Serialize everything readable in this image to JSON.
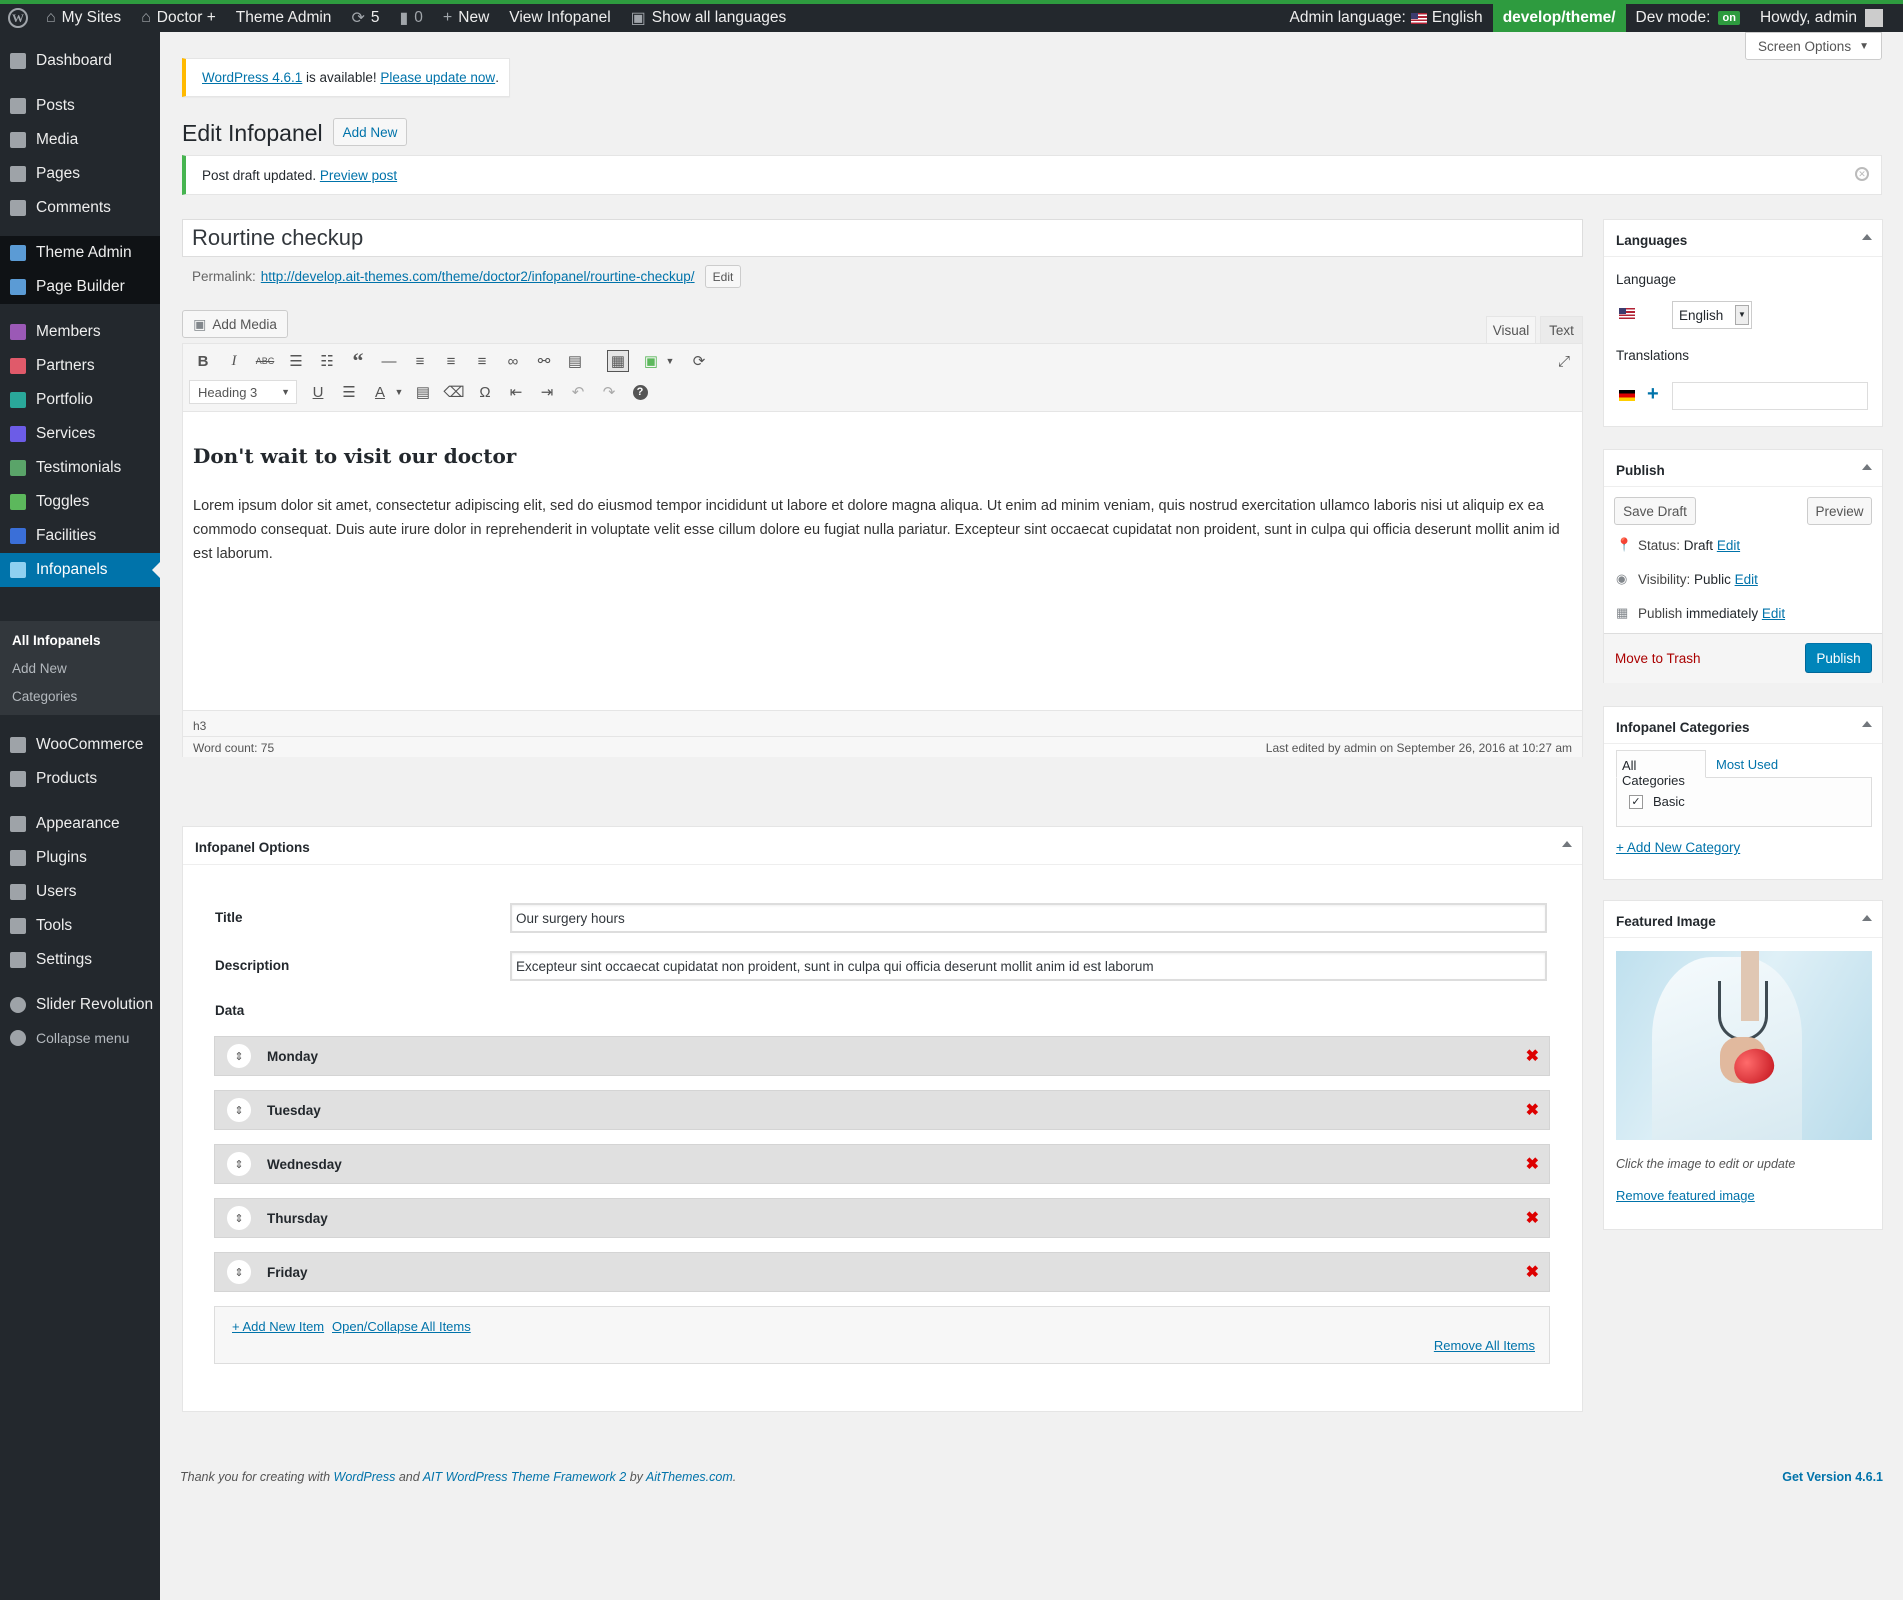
{
  "adminbar": {
    "my_sites": "My Sites",
    "site": "Doctor +",
    "theme_admin": "Theme Admin",
    "updates": "5",
    "comments": "0",
    "new": "New",
    "view": "View Infopanel",
    "show_langs": "Show all languages",
    "admin_lang_label": "Admin language:",
    "admin_lang_value": "English",
    "path": "develop/theme/",
    "dev_mode": "Dev mode:",
    "dev_state": "on",
    "howdy": "Howdy, admin"
  },
  "sidebar": {
    "items": [
      {
        "label": "Dashboard",
        "icon": "dashboard-icon"
      },
      {
        "label": "Posts",
        "icon": "pin-icon"
      },
      {
        "label": "Media",
        "icon": "media-icon"
      },
      {
        "label": "Pages",
        "icon": "pages-icon"
      },
      {
        "label": "Comments",
        "icon": "comments-icon"
      },
      {
        "label": "Theme Admin",
        "icon": "ait-icon"
      },
      {
        "label": "Page Builder",
        "icon": "ait-icon"
      },
      {
        "label": "Members",
        "icon": "members-icon"
      },
      {
        "label": "Partners",
        "icon": "partners-icon"
      },
      {
        "label": "Portfolio",
        "icon": "portfolio-icon"
      },
      {
        "label": "Services",
        "icon": "services-icon"
      },
      {
        "label": "Testimonials",
        "icon": "testimonials-icon"
      },
      {
        "label": "Toggles",
        "icon": "toggles-icon"
      },
      {
        "label": "Facilities",
        "icon": "facilities-icon"
      },
      {
        "label": "Infopanels",
        "icon": "infopanels-icon"
      },
      {
        "label": "WooCommerce",
        "icon": "woocommerce-icon"
      },
      {
        "label": "Products",
        "icon": "products-icon"
      },
      {
        "label": "Appearance",
        "icon": "appearance-icon"
      },
      {
        "label": "Plugins",
        "icon": "plugins-icon"
      },
      {
        "label": "Users",
        "icon": "users-icon"
      },
      {
        "label": "Tools",
        "icon": "tools-icon"
      },
      {
        "label": "Settings",
        "icon": "settings-icon"
      },
      {
        "label": "Slider Revolution",
        "icon": "refresh-icon"
      },
      {
        "label": "Collapse menu",
        "icon": "collapse-icon"
      }
    ],
    "submenu": [
      "All Infopanels",
      "Add New",
      "Categories"
    ]
  },
  "screen_options": "Screen Options",
  "notice": {
    "link": "WordPress 4.6.1",
    "text": " is available! ",
    "update": "Please update now",
    "end": "."
  },
  "page_title": "Edit Infopanel",
  "add_new": "Add New",
  "updated": {
    "text": "Post draft updated. ",
    "link": "Preview post"
  },
  "post_title": "Rourtine checkup",
  "permalink": {
    "label": "Permalink:",
    "url_base": "http://develop.ait-themes.com/theme/doctor2/infopanel/",
    "slug": "rourtine-checkup",
    "end": "/",
    "edit": "Edit"
  },
  "editor": {
    "add_media": "Add Media",
    "tab_visual": "Visual",
    "tab_text": "Text",
    "format": "Heading 3",
    "heading": "Don't wait to visit our doctor",
    "body": "Lorem ipsum dolor sit amet, consectetur adipiscing elit, sed do eiusmod tempor incididunt ut labore et dolore magna aliqua. Ut enim ad minim veniam, quis nostrud exercitation ullamco laboris nisi ut aliquip ex ea commodo consequat. Duis aute irure dolor in reprehenderit in voluptate velit esse cillum dolore eu fugiat nulla pariatur. Excepteur sint occaecat cupidatat non proident, sunt in culpa qui officia deserunt mollit anim id est laborum.",
    "path": "h3",
    "word_count": "Word count: 75",
    "last_edited": "Last edited by admin on September 26, 2016 at 10:27 am"
  },
  "options": {
    "title": "Infopanel Options",
    "title_label": "Title",
    "title_value": "Our surgery hours",
    "desc_label": "Description",
    "desc_value": "Excepteur sint occaecat cupidatat non proident, sunt in culpa qui officia deserunt mollit anim id est laborum",
    "data_label": "Data",
    "rows": [
      "Monday",
      "Tuesday",
      "Wednesday",
      "Thursday",
      "Friday"
    ],
    "add_item": "+ Add New Item",
    "toggle_all": "Open/Collapse All Items",
    "remove_all": "Remove All Items"
  },
  "languages": {
    "title": "Languages",
    "language": "Language",
    "value": "English",
    "translations": "Translations"
  },
  "publish": {
    "title": "Publish",
    "save": "Save Draft",
    "preview": "Preview",
    "status_label": "Status:",
    "status": "Draft",
    "visibility_label": "Visibility:",
    "visibility": "Public",
    "publish_label": "Publish",
    "publish_when": "immediately",
    "edit": "Edit",
    "trash": "Move to Trash",
    "publish_btn": "Publish"
  },
  "categories": {
    "title": "Infopanel Categories",
    "tab_all": "All Categories",
    "tab_used": "Most Used",
    "item": "Basic",
    "add": "+ Add New Category"
  },
  "featured": {
    "title": "Featured Image",
    "hint": "Click the image to edit or update",
    "remove": "Remove featured image"
  },
  "footer": {
    "t1": "Thank you for creating with ",
    "wp": "WordPress",
    "t2": " and ",
    "ait": "AIT WordPress Theme Framework 2",
    "t3": " by ",
    "site": "AitThemes.com",
    "t4": ".",
    "version": "Get Version 4.6.1"
  },
  "colors": {
    "accent": "#0073aa",
    "sidebar": "#23282d",
    "current": "#0073aa",
    "success": "#46b450",
    "warning": "#ffb900",
    "danger": "#dd0000"
  }
}
